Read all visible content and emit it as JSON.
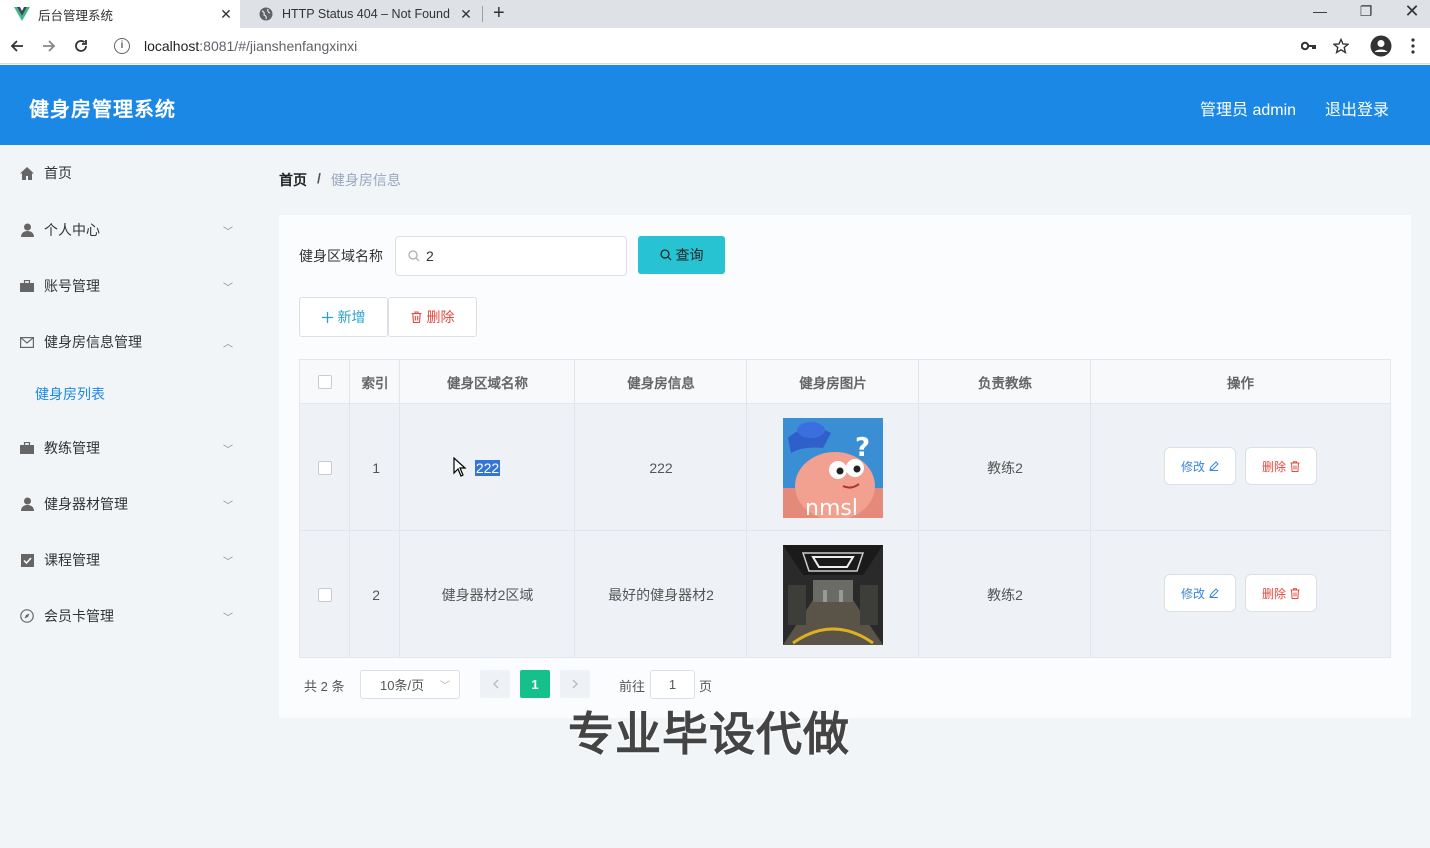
{
  "browser": {
    "tabs": [
      {
        "title": "后台管理系统",
        "active": true,
        "favicon": "vue-logo-icon"
      },
      {
        "title": "HTTP Status 404 – Not Found",
        "active": false,
        "favicon": "globe-icon"
      }
    ],
    "url_host": "localhost",
    "url_rest": ":8081/#/jianshenfangxinxi"
  },
  "header": {
    "app_title": "健身房管理系统",
    "user_label": "管理员 admin",
    "logout_label": "退出登录",
    "color": "#1b88e6"
  },
  "sidebar": {
    "items": [
      {
        "label": "首页",
        "icon": "home-icon"
      },
      {
        "label": "个人中心",
        "icon": "user-icon",
        "arrow": "down"
      },
      {
        "label": "账号管理",
        "icon": "briefcase-icon",
        "arrow": "down"
      },
      {
        "label": "健身房信息管理",
        "icon": "mail-icon",
        "arrow": "up"
      },
      {
        "label": "教练管理",
        "icon": "briefcase-icon",
        "arrow": "down"
      },
      {
        "label": "健身器材管理",
        "icon": "user-icon",
        "arrow": "down"
      },
      {
        "label": "课程管理",
        "icon": "checklist-icon",
        "arrow": "down"
      },
      {
        "label": "会员卡管理",
        "icon": "compass-icon",
        "arrow": "down"
      }
    ],
    "submenu": {
      "label": "健身房列表"
    }
  },
  "breadcrumb": {
    "home": "首页",
    "separator": "/",
    "current": "健身房信息"
  },
  "search": {
    "label": "健身区域名称",
    "value": "2",
    "button": "查询"
  },
  "actions": {
    "add": "新增",
    "delete": "删除"
  },
  "table": {
    "headers": [
      "索引",
      "健身区域名称",
      "健身房信息",
      "健身房图片",
      "负责教练",
      "操作"
    ],
    "rows": [
      {
        "index": "1",
        "area": "222",
        "info": "222",
        "image": "patrick-meme-image",
        "image_text": "nmsl",
        "coach": "教练2"
      },
      {
        "index": "2",
        "area": "健身器材2区域",
        "info": "最好的健身器材2",
        "image": "gym-interior-image",
        "coach": "教练2"
      }
    ],
    "edit_label": "修改",
    "delete_label": "删除"
  },
  "pagination": {
    "total": "共 2 条",
    "page_size": "10条/页",
    "current_page": "1",
    "goto_prefix": "前往",
    "goto_value": "1",
    "goto_suffix": "页"
  },
  "watermark": "专业毕设代做"
}
